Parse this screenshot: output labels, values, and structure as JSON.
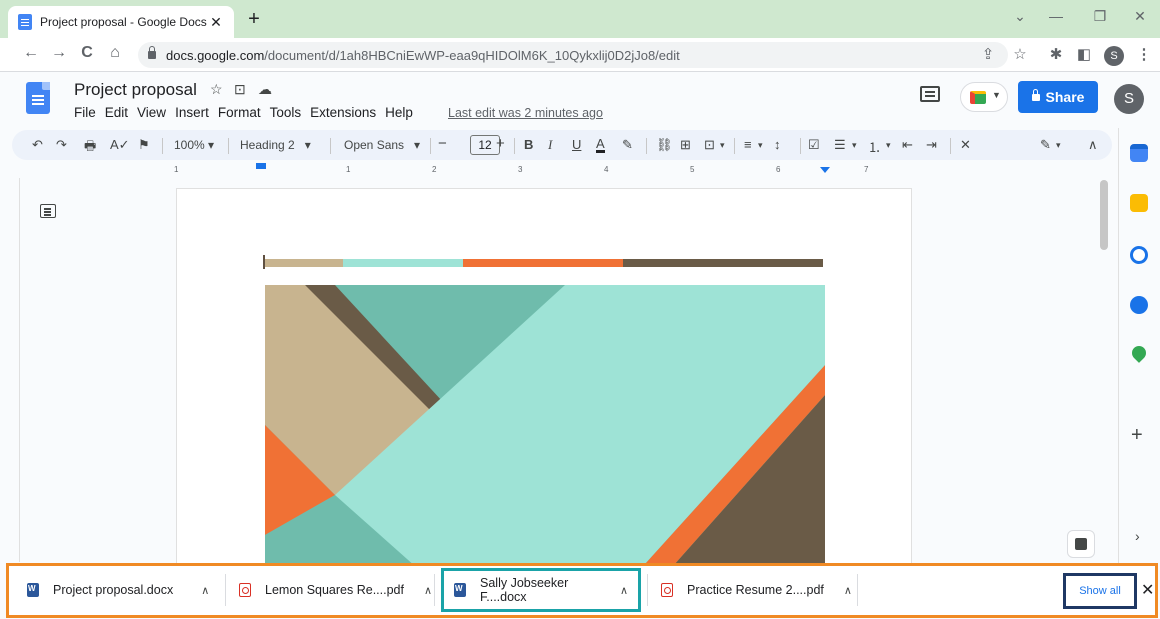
{
  "browser": {
    "tab_title": "Project proposal - Google Docs",
    "tab_close": "✕",
    "new_tab": "+",
    "window_controls": {
      "chevron": "⌄",
      "minimize": "—",
      "restore": "❐",
      "close": "✕"
    },
    "nav": {
      "back": "←",
      "forward": "→",
      "reload": "C",
      "home": "⌂"
    },
    "url_host": "docs.google.com",
    "url_path": "/document/d/1ah8HBCniEwWP-eaa9qHIDOlM6K_10Qykxlij0D2jJo8/edit",
    "right_icons": {
      "share": "⇪",
      "star": "☆",
      "extensions": "✱",
      "sidepanel": "◧",
      "menu": "⋮"
    },
    "profile_initial": "S"
  },
  "docs": {
    "title": "Project proposal",
    "title_icons": {
      "star": "☆",
      "move": "⊡",
      "cloud": "☁"
    },
    "menu": [
      "File",
      "Edit",
      "View",
      "Insert",
      "Format",
      "Tools",
      "Extensions",
      "Help"
    ],
    "last_edit": "Last edit was 2 minutes ago",
    "share_label": "Share",
    "avatar_initial": "S"
  },
  "toolbar": {
    "undo": "↶",
    "redo": "↷",
    "print": "🖶",
    "spell": "A✓",
    "paint": "⚑",
    "zoom": "100%",
    "style": "Heading 2",
    "font": "Open Sans",
    "minus": "−",
    "font_size": "12",
    "plus": "+",
    "bold": "B",
    "italic": "I",
    "underline": "U",
    "text_color": "A",
    "highlight": "✎",
    "link": "⛓",
    "comment": "⊞",
    "image": "⊡",
    "align": "≡",
    "line_spacing": "↕",
    "checklist": "☑",
    "bullets": "☰",
    "numbered": "⒈",
    "outdent": "⇤",
    "indent": "⇥",
    "clear": "✕",
    "edit_mode": "✎",
    "collapse": "∧"
  },
  "ruler": [
    "1",
    "1",
    "2",
    "3",
    "4",
    "5",
    "6",
    "7"
  ],
  "colorbar_colors": [
    "#c8b48f",
    "#9ee3d6",
    "#f07135",
    "#6a5b47"
  ],
  "image_colors": {
    "teal": "#6fbcac",
    "mint": "#9ee3d6",
    "tan": "#c8b48f",
    "brown": "#6a5b47",
    "orange": "#f07135"
  },
  "side_panel": {
    "add": "+",
    "expand": "›"
  },
  "downloads": {
    "items": [
      {
        "name": "Project proposal.docx",
        "type": "word"
      },
      {
        "name": "Lemon Squares Re....pdf",
        "type": "pdf"
      },
      {
        "name": "Sally Jobseeker F....docx",
        "type": "word"
      },
      {
        "name": "Practice Resume 2....pdf",
        "type": "pdf"
      }
    ],
    "caret": "∧",
    "show_all": "Show all",
    "close": "✕"
  }
}
